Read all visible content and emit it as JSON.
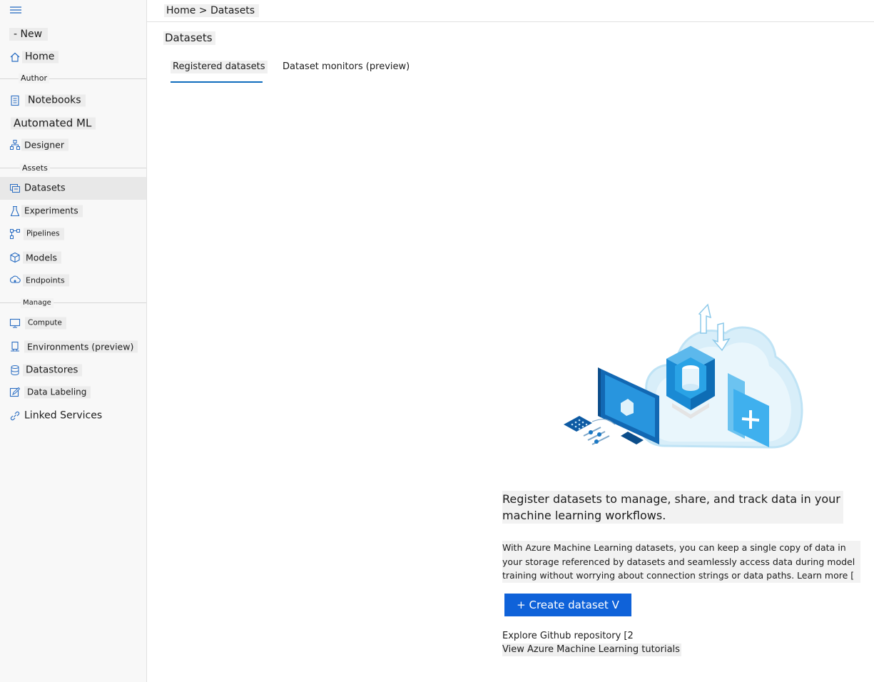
{
  "sidebar": {
    "new_label": "- New",
    "home_label": "Home",
    "sections": {
      "author": "Author",
      "assets": "Assets",
      "manage": "Manage"
    },
    "items": {
      "notebooks": "Notebooks",
      "automated_ml": "Automated ML",
      "designer": "Designer",
      "datasets": "Datasets",
      "experiments": "Experiments",
      "pipelines": "Pipelines",
      "models": "Models",
      "endpoints": "Endpoints",
      "compute": "Compute",
      "environments": "Environments (preview)",
      "datastores": "Datastores",
      "data_labeling": "Data Labeling",
      "linked_services": "Linked Services"
    },
    "active_item": "datasets"
  },
  "header": {
    "breadcrumb": "Home > Datasets"
  },
  "main": {
    "title": "Datasets",
    "tabs": {
      "registered": "Registered datasets",
      "monitors": "Dataset monitors (preview)"
    },
    "active_tab": "registered",
    "empty_state": {
      "headline": "Register datasets to manage, share, and track data in your machine learning workflows.",
      "description": "With Azure Machine Learning datasets, you can keep a single copy of data in your storage referenced by datasets and seamlessly access data during model training without worrying about connection strings or data paths. Learn more [",
      "create_button": "+ Create dataset V",
      "github_link": "Explore Github repository [2",
      "tutorials_link": "View Azure Machine Learning tutorials"
    }
  },
  "colors": {
    "accent": "#0f62d9",
    "tab_underline": "#0f6cbd",
    "sidebar_bg": "#f8f8f8",
    "icon_blue": "#2a6dc2"
  }
}
